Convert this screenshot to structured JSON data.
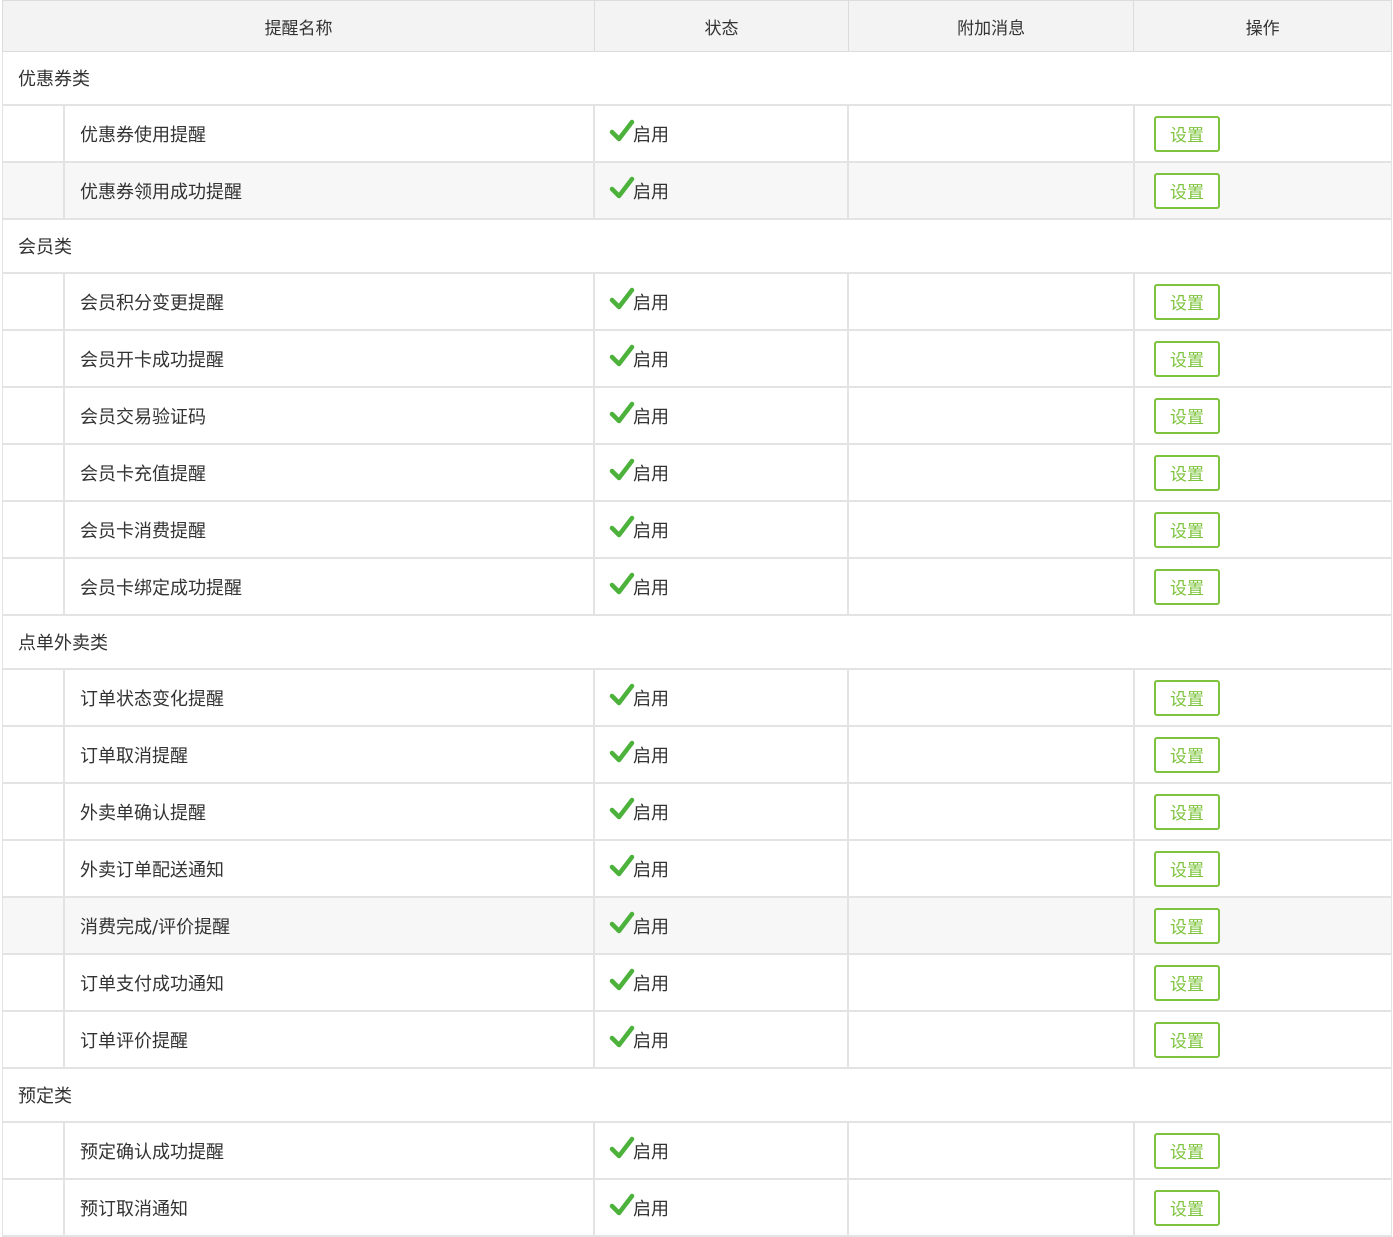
{
  "columns": [
    "提醒名称",
    "状态",
    "附加消息",
    "操作"
  ],
  "status_label": "启用",
  "action_label": "设置",
  "accent_color": "#7dc33d",
  "check_color": "#4cb23c",
  "icons": {
    "status": "check-icon"
  },
  "groups": [
    {
      "category": "优惠券类",
      "items": [
        {
          "name": "优惠券使用提醒",
          "status": "启用",
          "message": "",
          "action": "设置"
        },
        {
          "name": "优惠券领用成功提醒",
          "status": "启用",
          "message": "",
          "action": "设置",
          "highlight": true
        }
      ]
    },
    {
      "category": "会员类",
      "items": [
        {
          "name": "会员积分变更提醒",
          "status": "启用",
          "message": "",
          "action": "设置"
        },
        {
          "name": "会员开卡成功提醒",
          "status": "启用",
          "message": "",
          "action": "设置"
        },
        {
          "name": "会员交易验证码",
          "status": "启用",
          "message": "",
          "action": "设置"
        },
        {
          "name": "会员卡充值提醒",
          "status": "启用",
          "message": "",
          "action": "设置"
        },
        {
          "name": "会员卡消费提醒",
          "status": "启用",
          "message": "",
          "action": "设置"
        },
        {
          "name": "会员卡绑定成功提醒",
          "status": "启用",
          "message": "",
          "action": "设置"
        }
      ]
    },
    {
      "category": "点单外卖类",
      "items": [
        {
          "name": "订单状态变化提醒",
          "status": "启用",
          "message": "",
          "action": "设置"
        },
        {
          "name": "订单取消提醒",
          "status": "启用",
          "message": "",
          "action": "设置"
        },
        {
          "name": "外卖单确认提醒",
          "status": "启用",
          "message": "",
          "action": "设置"
        },
        {
          "name": "外卖订单配送通知",
          "status": "启用",
          "message": "",
          "action": "设置"
        },
        {
          "name": "消费完成/评价提醒",
          "status": "启用",
          "message": "",
          "action": "设置",
          "highlight": true
        },
        {
          "name": "订单支付成功通知",
          "status": "启用",
          "message": "",
          "action": "设置"
        },
        {
          "name": "订单评价提醒",
          "status": "启用",
          "message": "",
          "action": "设置"
        }
      ]
    },
    {
      "category": "预定类",
      "items": [
        {
          "name": "预定确认成功提醒",
          "status": "启用",
          "message": "",
          "action": "设置"
        },
        {
          "name": "预订取消通知",
          "status": "启用",
          "message": "",
          "action": "设置"
        }
      ]
    }
  ]
}
